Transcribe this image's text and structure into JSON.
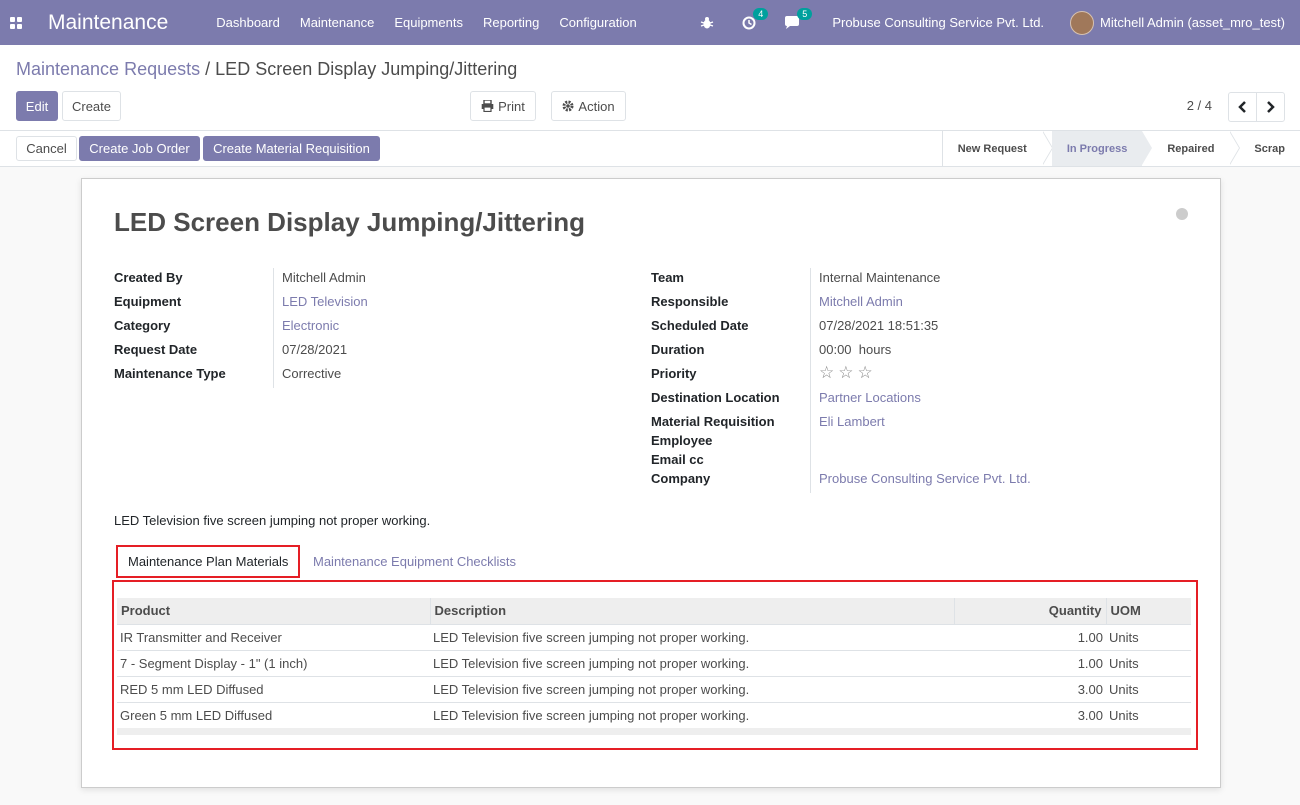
{
  "topbar": {
    "app_title": "Maintenance",
    "menu": [
      "Dashboard",
      "Maintenance",
      "Equipments",
      "Reporting",
      "Configuration"
    ],
    "activity_count": "4",
    "message_count": "5",
    "company": "Probuse Consulting Service Pvt. Ltd.",
    "user": "Mitchell Admin (asset_mro_test)"
  },
  "breadcrumb": {
    "parent": "Maintenance Requests",
    "separator": "/",
    "current": "LED Screen Display Jumping/Jittering"
  },
  "toolbar": {
    "edit": "Edit",
    "create": "Create",
    "print": "Print",
    "action": "Action",
    "pager": "2 / 4"
  },
  "statusbar": {
    "cancel": "Cancel",
    "create_job_order": "Create Job Order",
    "create_material_requisition": "Create Material Requisition",
    "stages": [
      "New Request",
      "In Progress",
      "Repaired",
      "Scrap"
    ],
    "active_stage": "In Progress"
  },
  "form": {
    "title": "LED Screen Display Jumping/Jittering",
    "left": [
      {
        "label": "Created By",
        "value": "Mitchell Admin"
      },
      {
        "label": "Equipment",
        "value": "LED Television"
      },
      {
        "label": "Category",
        "value": "Electronic"
      },
      {
        "label": "Request Date",
        "value": "07/28/2021"
      },
      {
        "label": "Maintenance Type",
        "value": "Corrective"
      }
    ],
    "right": [
      {
        "label": "Team",
        "value": "Internal Maintenance"
      },
      {
        "label": "Responsible",
        "value": "Mitchell Admin"
      },
      {
        "label": "Scheduled Date",
        "value": "07/28/2021 18:51:35"
      },
      {
        "label": "Duration",
        "value": "00:00  hours"
      },
      {
        "label": "Priority",
        "value": "0"
      },
      {
        "label": "Destination Location",
        "value": "Partner Locations"
      },
      {
        "label": "Material Requisition Employee",
        "value": "Eli Lambert"
      },
      {
        "label": "Email cc",
        "value": ""
      },
      {
        "label": "Company",
        "value": "Probuse Consulting Service Pvt. Ltd."
      }
    ],
    "description": "LED Television five screen jumping not proper working."
  },
  "tabs": [
    "Maintenance Plan Materials",
    "Maintenance Equipment Checklists"
  ],
  "materials": {
    "columns": [
      "Product",
      "Description",
      "Quantity",
      "UOM"
    ],
    "rows": [
      [
        "IR Transmitter and Receiver",
        "LED Television five screen jumping not proper working.",
        "1.00",
        "Units"
      ],
      [
        "7 - Segment Display - 1\" (1 inch)",
        "LED Television five screen jumping not proper working.",
        "1.00",
        "Units"
      ],
      [
        "RED 5 mm LED Diffused",
        "LED Television five screen jumping not proper working.",
        "3.00",
        "Units"
      ],
      [
        "Green 5 mm LED Diffused",
        "LED Television five screen jumping not proper working.",
        "3.00",
        "Units"
      ]
    ]
  },
  "colors": {
    "brand": "#7c7bad",
    "highlight": "#e51e25"
  }
}
